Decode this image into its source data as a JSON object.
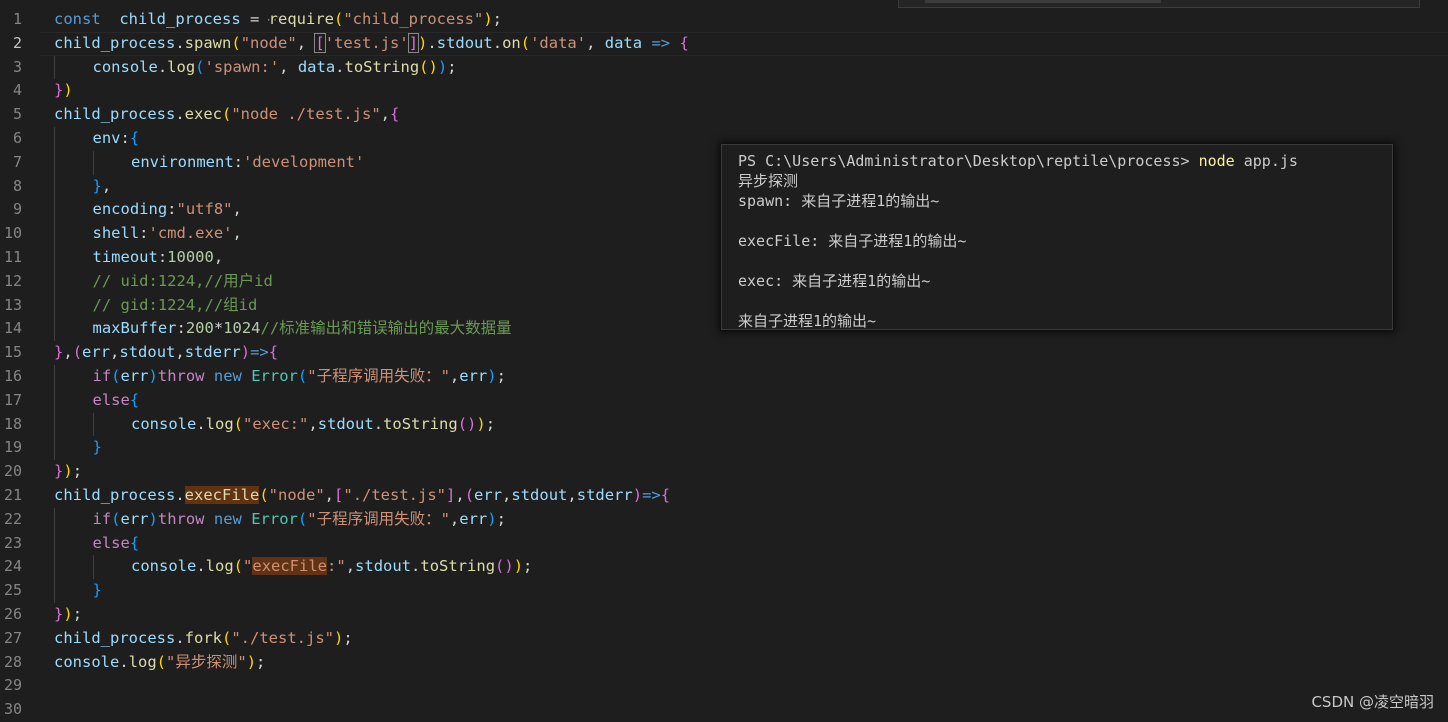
{
  "editor": {
    "active_line": 2,
    "lines": [
      {
        "n": "1",
        "indent": 0,
        "tokens": [
          [
            "kw",
            "const"
          ],
          [
            "",
            "  "
          ],
          [
            "var",
            "child_process"
          ],
          [
            "",
            " = "
          ],
          [
            "fn",
            "require"
          ],
          [
            "b1",
            "("
          ],
          [
            "str",
            "\"child_process\""
          ],
          [
            "b1",
            ")"
          ],
          [
            "",
            ";"
          ]
        ]
      },
      {
        "n": "2",
        "indent": 0,
        "tokens": [
          [
            "var",
            "child_process"
          ],
          [
            "",
            "."
          ],
          [
            "fn",
            "spawn"
          ],
          [
            "b1",
            "("
          ],
          [
            "str",
            "\"node\""
          ],
          [
            "",
            ", "
          ],
          [
            "b2bm",
            "["
          ],
          [
            "str",
            "'test.js'"
          ],
          [
            "b2bm",
            "]"
          ],
          [
            "b1",
            ")"
          ],
          [
            "",
            "."
          ],
          [
            "var",
            "stdout"
          ],
          [
            "",
            "."
          ],
          [
            "fn",
            "on"
          ],
          [
            "b1",
            "("
          ],
          [
            "str",
            "'data'"
          ],
          [
            "",
            ", "
          ],
          [
            "var",
            "data"
          ],
          [
            "",
            " "
          ],
          [
            "kw",
            "=>"
          ],
          [
            "",
            " "
          ],
          [
            "b2",
            "{"
          ]
        ]
      },
      {
        "n": "3",
        "indent": 1,
        "tokens": [
          [
            "var",
            "console"
          ],
          [
            "",
            "."
          ],
          [
            "fn",
            "log"
          ],
          [
            "b3",
            "("
          ],
          [
            "str",
            "'spawn:'"
          ],
          [
            "",
            ", "
          ],
          [
            "var",
            "data"
          ],
          [
            "",
            "."
          ],
          [
            "fn",
            "toString"
          ],
          [
            "b1",
            "()"
          ],
          [
            "b3",
            ")"
          ],
          [
            "",
            ";"
          ]
        ]
      },
      {
        "n": "4",
        "indent": 0,
        "tokens": [
          [
            "b2",
            "}"
          ],
          [
            "b1",
            ")"
          ]
        ]
      },
      {
        "n": "5",
        "indent": 0,
        "tokens": [
          [
            "var",
            "child_process"
          ],
          [
            "",
            "."
          ],
          [
            "fn",
            "exec"
          ],
          [
            "b1",
            "("
          ],
          [
            "str",
            "\"node ./test.js\""
          ],
          [
            "",
            ","
          ],
          [
            "b2",
            "{"
          ]
        ]
      },
      {
        "n": "6",
        "indent": 1,
        "tokens": [
          [
            "var",
            "env"
          ],
          [
            "",
            ":"
          ],
          [
            "b3",
            "{"
          ]
        ]
      },
      {
        "n": "7",
        "indent": 2,
        "tokens": [
          [
            "var",
            "environment"
          ],
          [
            "",
            ":"
          ],
          [
            "str",
            "'development'"
          ]
        ]
      },
      {
        "n": "8",
        "indent": 1,
        "tokens": [
          [
            "b3",
            "}"
          ],
          [
            "",
            ","
          ]
        ]
      },
      {
        "n": "9",
        "indent": 1,
        "tokens": [
          [
            "var",
            "encoding"
          ],
          [
            "",
            ":"
          ],
          [
            "str",
            "\"utf8\""
          ],
          [
            "",
            ","
          ]
        ]
      },
      {
        "n": "10",
        "indent": 1,
        "tokens": [
          [
            "var",
            "shell"
          ],
          [
            "",
            ":"
          ],
          [
            "str",
            "'cmd.exe'"
          ],
          [
            "",
            ","
          ]
        ]
      },
      {
        "n": "11",
        "indent": 1,
        "tokens": [
          [
            "var",
            "timeout"
          ],
          [
            "",
            ":"
          ],
          [
            "num",
            "10000"
          ],
          [
            "",
            ","
          ]
        ]
      },
      {
        "n": "12",
        "indent": 1,
        "tokens": [
          [
            "cmt",
            "// uid:1224,//用户id"
          ]
        ]
      },
      {
        "n": "13",
        "indent": 1,
        "tokens": [
          [
            "cmt",
            "// gid:1224,//组id"
          ]
        ]
      },
      {
        "n": "14",
        "indent": 1,
        "tokens": [
          [
            "var",
            "maxBuffer"
          ],
          [
            "",
            ":"
          ],
          [
            "num",
            "200"
          ],
          [
            "",
            "*"
          ],
          [
            "num",
            "1024"
          ],
          [
            "cmt",
            "//标准输出和错误输出的最大数据量"
          ]
        ]
      },
      {
        "n": "15",
        "indent": 0,
        "tokens": [
          [
            "b2",
            "}"
          ],
          [
            "",
            ","
          ],
          [
            "b2",
            "("
          ],
          [
            "var",
            "err"
          ],
          [
            "",
            ","
          ],
          [
            "var",
            "stdout"
          ],
          [
            "",
            ","
          ],
          [
            "var",
            "stderr"
          ],
          [
            "b2",
            ")"
          ],
          [
            "kw",
            "=>"
          ],
          [
            "b2",
            "{"
          ]
        ]
      },
      {
        "n": "16",
        "indent": 1,
        "tokens": [
          [
            "ctl",
            "if"
          ],
          [
            "b3",
            "("
          ],
          [
            "var",
            "err"
          ],
          [
            "b3",
            ")"
          ],
          [
            "ctl",
            "throw"
          ],
          [
            "",
            " "
          ],
          [
            "kw",
            "new"
          ],
          [
            "",
            " "
          ],
          [
            "cls",
            "Error"
          ],
          [
            "b3",
            "("
          ],
          [
            "str",
            "\"子程序调用失败：\""
          ],
          [
            "",
            ","
          ],
          [
            "var",
            "err"
          ],
          [
            "b3",
            ")"
          ],
          [
            "",
            ";"
          ]
        ]
      },
      {
        "n": "17",
        "indent": 1,
        "tokens": [
          [
            "ctl",
            "else"
          ],
          [
            "b3",
            "{"
          ]
        ]
      },
      {
        "n": "18",
        "indent": 2,
        "tokens": [
          [
            "var",
            "console"
          ],
          [
            "",
            "."
          ],
          [
            "fn",
            "log"
          ],
          [
            "b1",
            "("
          ],
          [
            "str",
            "\"exec:\""
          ],
          [
            "",
            ","
          ],
          [
            "var",
            "stdout"
          ],
          [
            "",
            "."
          ],
          [
            "fn",
            "toString"
          ],
          [
            "b2",
            "()"
          ],
          [
            "b1",
            ")"
          ],
          [
            "",
            ";"
          ]
        ]
      },
      {
        "n": "19",
        "indent": 1,
        "tokens": [
          [
            "b3",
            "}"
          ]
        ]
      },
      {
        "n": "20",
        "indent": 0,
        "tokens": [
          [
            "b2",
            "}"
          ],
          [
            "b1",
            ")"
          ],
          [
            "",
            ";"
          ]
        ]
      },
      {
        "n": "21",
        "indent": 0,
        "tokens": [
          [
            "var",
            "child_process"
          ],
          [
            "",
            "."
          ],
          [
            "fnhl",
            "execFile"
          ],
          [
            "b1",
            "("
          ],
          [
            "str",
            "\"node\""
          ],
          [
            "",
            ","
          ],
          [
            "b2",
            "["
          ],
          [
            "str",
            "\"./test.js\""
          ],
          [
            "b2",
            "]"
          ],
          [
            "",
            ","
          ],
          [
            "b2",
            "("
          ],
          [
            "var",
            "err"
          ],
          [
            "",
            ","
          ],
          [
            "var",
            "stdout"
          ],
          [
            "",
            ","
          ],
          [
            "var",
            "stderr"
          ],
          [
            "b2",
            ")"
          ],
          [
            "kw",
            "=>"
          ],
          [
            "b2",
            "{"
          ]
        ]
      },
      {
        "n": "22",
        "indent": 1,
        "tokens": [
          [
            "ctl",
            "if"
          ],
          [
            "b3",
            "("
          ],
          [
            "var",
            "err"
          ],
          [
            "b3",
            ")"
          ],
          [
            "ctl",
            "throw"
          ],
          [
            "",
            " "
          ],
          [
            "kw",
            "new"
          ],
          [
            "",
            " "
          ],
          [
            "cls",
            "Error"
          ],
          [
            "b3",
            "("
          ],
          [
            "str",
            "\"子程序调用失败：\""
          ],
          [
            "",
            ","
          ],
          [
            "var",
            "err"
          ],
          [
            "b3",
            ")"
          ],
          [
            "",
            ";"
          ]
        ]
      },
      {
        "n": "23",
        "indent": 1,
        "tokens": [
          [
            "ctl",
            "else"
          ],
          [
            "b3",
            "{"
          ]
        ]
      },
      {
        "n": "24",
        "indent": 2,
        "tokens": [
          [
            "var",
            "console"
          ],
          [
            "",
            "."
          ],
          [
            "fn",
            "log"
          ],
          [
            "b1",
            "("
          ],
          [
            "str",
            "\""
          ],
          [
            "strhl",
            "execFile"
          ],
          [
            "str",
            ":\""
          ],
          [
            "",
            ","
          ],
          [
            "var",
            "stdout"
          ],
          [
            "",
            "."
          ],
          [
            "fn",
            "toString"
          ],
          [
            "b2",
            "()"
          ],
          [
            "b1",
            ")"
          ],
          [
            "",
            ";"
          ]
        ]
      },
      {
        "n": "25",
        "indent": 1,
        "tokens": [
          [
            "b3",
            "}"
          ]
        ]
      },
      {
        "n": "26",
        "indent": 0,
        "tokens": [
          [
            "b2",
            "}"
          ],
          [
            "b1",
            ")"
          ],
          [
            "",
            ";"
          ]
        ]
      },
      {
        "n": "27",
        "indent": 0,
        "tokens": [
          [
            "var",
            "child_process"
          ],
          [
            "",
            "."
          ],
          [
            "fn",
            "fork"
          ],
          [
            "b1",
            "("
          ],
          [
            "str",
            "\"./test.js\""
          ],
          [
            "b1",
            ")"
          ],
          [
            "",
            ";"
          ]
        ]
      },
      {
        "n": "28",
        "indent": 0,
        "tokens": [
          [
            "var",
            "console"
          ],
          [
            "",
            "."
          ],
          [
            "fn",
            "log"
          ],
          [
            "b1",
            "("
          ],
          [
            "str",
            "\"异步探测\""
          ],
          [
            "b1",
            ")"
          ],
          [
            "",
            ";"
          ]
        ]
      },
      {
        "n": "29",
        "indent": 0,
        "tokens": []
      },
      {
        "n": "30",
        "indent": 0,
        "tokens": []
      }
    ]
  },
  "terminal": {
    "prompt": "PS C:\\Users\\Administrator\\Desktop\\reptile\\process> ",
    "command": "node",
    "command_args": " app.js",
    "output": [
      "异步探测",
      "spawn: 来自子进程1的输出~",
      "",
      "execFile: 来自子进程1的输出~",
      "",
      "exec: 来自子进程1的输出~",
      "",
      "来自子进程1的输出~"
    ]
  },
  "watermark": "CSDN @凌空暗羽",
  "colors": {
    "background": "#1e1e1e",
    "keyword": "#569cd6",
    "control": "#c586c0",
    "variable": "#9cdcfe",
    "function": "#dcdcaa",
    "string": "#ce9178",
    "number": "#b5cea8",
    "comment": "#6a9955",
    "class": "#4ec9b0"
  }
}
